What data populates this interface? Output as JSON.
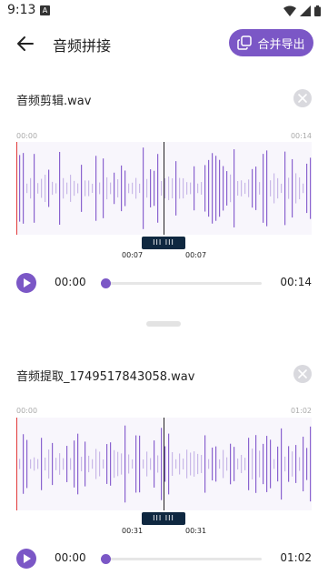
{
  "status_bar": {
    "time": "9:13",
    "a_icon": "A"
  },
  "header": {
    "back_icon": "arrow-left-icon",
    "title": "音频拼接",
    "merge_button": "合并导出",
    "merge_icon": "merge-copy-icon"
  },
  "colors": {
    "accent": "#7B57C6",
    "handle": "#0f2840",
    "start_marker": "#e23a3a"
  },
  "tracks": [
    {
      "file_name": "音频剪辑.wav",
      "range_start": "00:00",
      "range_end": "00:14",
      "marker_left": "00:07",
      "marker_right": "00:07",
      "handle_label": "III  III",
      "current_time": "00:00",
      "total_time": "00:14",
      "progress": 0.0
    },
    {
      "file_name": "音频提取_1749517843058.wav",
      "range_start": "00:00",
      "range_end": "01:02",
      "marker_left": "00:31",
      "marker_right": "00:31",
      "handle_label": "III  III",
      "current_time": "00:00",
      "total_time": "01:02",
      "progress": 0.0
    }
  ]
}
